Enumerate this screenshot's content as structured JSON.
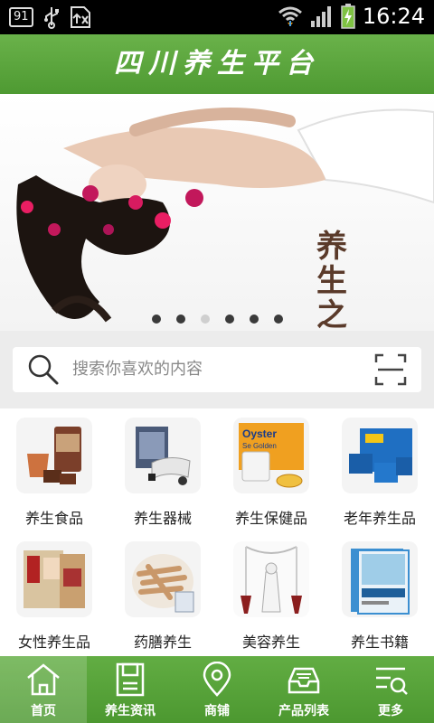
{
  "status_bar": {
    "notification_badge": "91",
    "time": "16:24"
  },
  "header": {
    "title": "四川养生平台"
  },
  "banner": {
    "caption": "养生之道",
    "slide_count": 6,
    "active_slide": 3
  },
  "search": {
    "placeholder": "搜索你喜欢的内容"
  },
  "categories": [
    {
      "label": "养生食品",
      "icon": "tea-jar-image"
    },
    {
      "label": "养生器械",
      "icon": "massager-image"
    },
    {
      "label": "养生保健品",
      "icon": "oyster-supplement-image"
    },
    {
      "label": "老年养生品",
      "icon": "supplement-box-image"
    },
    {
      "label": "女性养生品",
      "icon": "red-date-box-image"
    },
    {
      "label": "药膳养生",
      "icon": "herb-slices-image"
    },
    {
      "label": "美容养生",
      "icon": "beauty-device-image"
    },
    {
      "label": "养生书籍",
      "icon": "book-image"
    }
  ],
  "tabbar": {
    "items": [
      {
        "label": "首页",
        "icon": "home-icon",
        "active": true
      },
      {
        "label": "养生资讯",
        "icon": "news-icon",
        "active": false
      },
      {
        "label": "商铺",
        "icon": "location-pin-icon",
        "active": false
      },
      {
        "label": "产品列表",
        "icon": "inbox-tray-icon",
        "active": false
      },
      {
        "label": "更多",
        "icon": "more-search-icon",
        "active": false
      }
    ]
  },
  "colors": {
    "brand_green": "#5aa63c",
    "dot_inactive": "#3a3a3a",
    "dot_active": "#cfcfcf"
  }
}
